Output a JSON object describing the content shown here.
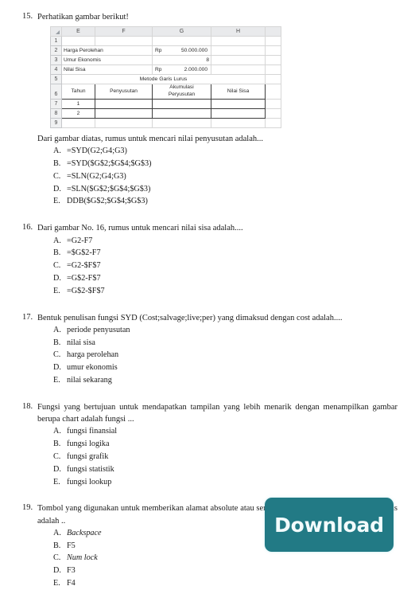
{
  "page": {
    "accent_color": "#227a85"
  },
  "q15": {
    "number": "15.",
    "stem": "Perhatikan gambar berikut!",
    "question": "Dari gambar diatas, rumus untuk mencari nilai penyusutan adalah...",
    "spreadsheet": {
      "column_headers": [
        "E",
        "F",
        "G",
        "H"
      ],
      "row_headers": [
        "1",
        "2",
        "3",
        "4",
        "5",
        "6",
        "7",
        "8",
        "9"
      ],
      "label_harga": "Harga Perolehan",
      "currency_harga": "Rp",
      "value_harga": "50.000.000",
      "label_umur": "Umur Ekonomis",
      "value_umur": "8",
      "label_nilai_sisa": "Nilai Sisa",
      "currency_sisa": "Rp",
      "value_sisa": "2.000.000",
      "method_title": "Metode Garis Lurus",
      "table_headers": [
        "Tahun",
        "Penyusutan",
        "Akumulasi Peryusutan",
        "Nilai Sisa"
      ],
      "table_header_akumulasi_line1": "Akumulasi",
      "table_header_akumulasi_line2": "Peryusutan",
      "year_row_1": "1",
      "year_row_2": "2"
    },
    "options": [
      {
        "letter": "A.",
        "text": "=SYD(G2;G4;G3)"
      },
      {
        "letter": "B.",
        "text": "=SYD($G$2;$G$4;$G$3)"
      },
      {
        "letter": "C.",
        "text": "=SLN(G2;G4;G3)"
      },
      {
        "letter": "D.",
        "text": "=SLN($G$2;$G$4;$G$3)"
      },
      {
        "letter": "E.",
        "text": "DDB($G$2;$G$4;$G$3)"
      }
    ]
  },
  "q16": {
    "number": "16.",
    "stem": "Dari gambar No. 16, rumus untuk mencari nilai sisa adalah....",
    "options": [
      {
        "letter": "A.",
        "text": "=G2-F7"
      },
      {
        "letter": "B.",
        "text": "=$G$2-F7"
      },
      {
        "letter": "C.",
        "text": "=G2-$F$7"
      },
      {
        "letter": "D.",
        "text": "=G$2-F$7"
      },
      {
        "letter": "E.",
        "text": "=G$2-$F$7"
      }
    ]
  },
  "q17": {
    "number": "17.",
    "stem": "Bentuk penulisan fungsi SYD (Cost;salvage;live;per) yang dimaksud dengan cost adalah....",
    "options": [
      {
        "letter": "A.",
        "text": "periode penyusutan"
      },
      {
        "letter": "B.",
        "text": "nilai sisa"
      },
      {
        "letter": "C.",
        "text": "harga perolehan"
      },
      {
        "letter": "D.",
        "text": "umur ekonomis"
      },
      {
        "letter": "E.",
        "text": "nilai sekarang"
      }
    ]
  },
  "q18": {
    "number": "18.",
    "stem": "Fungsi yang bertujuan untuk mendapatkan tampilan yang lebih menarik dengan menampilkan gambar berupa chart adalah fungsi ...",
    "options": [
      {
        "letter": "A.",
        "text": "fungsi finansial"
      },
      {
        "letter": "B.",
        "text": "fungsi logika"
      },
      {
        "letter": "C.",
        "text": "fungsi grafik"
      },
      {
        "letter": "D.",
        "text": "fungsi statistik"
      },
      {
        "letter": "E.",
        "text": "fungsi lookup"
      }
    ]
  },
  "q19": {
    "number": "19.",
    "stem": "Tombol yang digunakan untuk memberikan alamat absolute atau semi absolute atau untuk mengunci rumus adalah ..",
    "options": [
      {
        "letter": "A.",
        "text": "Backspace",
        "italic": true
      },
      {
        "letter": "B.",
        "text": "F5",
        "italic": false
      },
      {
        "letter": "C.",
        "text": "Num lock",
        "italic": true
      },
      {
        "letter": "D.",
        "text": "F3",
        "italic": false
      },
      {
        "letter": "E.",
        "text": "F4",
        "italic": false
      }
    ]
  },
  "download": {
    "label": "Download"
  }
}
